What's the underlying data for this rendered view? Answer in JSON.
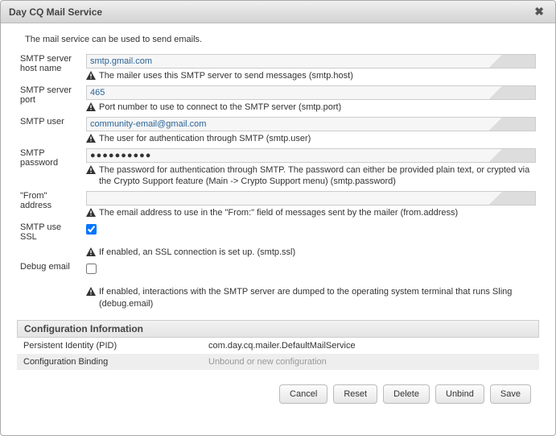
{
  "dialog": {
    "title": "Day CQ Mail Service",
    "description": "The mail service can be used to send emails."
  },
  "fields": {
    "smtp_host": {
      "label": "SMTP server host name",
      "value": "smtp.gmail.com",
      "hint": "The mailer uses this SMTP server to send messages (smtp.host)"
    },
    "smtp_port": {
      "label": "SMTP server port",
      "value": "465",
      "hint": "Port number to use to connect to the SMTP server (smtp.port)"
    },
    "smtp_user": {
      "label": "SMTP user",
      "value": "community-email@gmail.com",
      "hint": "The user for authentication through SMTP (smtp.user)"
    },
    "smtp_password": {
      "label": "SMTP password",
      "value": "●●●●●●●●●●",
      "hint": "The password for authentication through SMTP. The password can either be provided plain text, or crypted via the Crypto Support feature (Main -> Crypto Support menu) (smtp.password)"
    },
    "from_address": {
      "label": "\"From\" address",
      "value": "",
      "hint": "The email address to use in the \"From:\" field of messages sent by the mailer (from.address)"
    },
    "smtp_ssl": {
      "label": "SMTP use SSL",
      "checked": true,
      "hint": "If enabled, an SSL connection is set up. (smtp.ssl)"
    },
    "debug_email": {
      "label": "Debug email",
      "checked": false,
      "hint": "If enabled, interactions with the SMTP server are dumped to the operating system terminal that runs Sling (debug.email)"
    }
  },
  "config_section": {
    "header": "Configuration Information",
    "pid_label": "Persistent Identity (PID)",
    "pid_value": "com.day.cq.mailer.DefaultMailService",
    "binding_label": "Configuration Binding",
    "binding_value": "Unbound or new configuration"
  },
  "buttons": {
    "cancel": "Cancel",
    "reset": "Reset",
    "delete": "Delete",
    "unbind": "Unbind",
    "save": "Save"
  }
}
